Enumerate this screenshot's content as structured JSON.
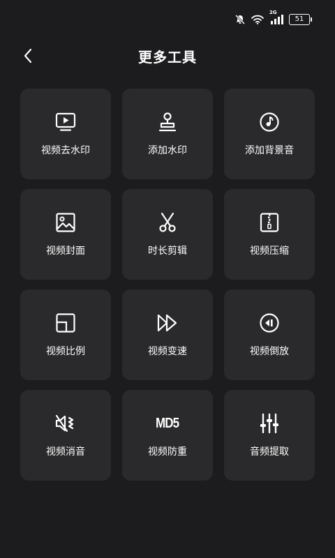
{
  "status_bar": {
    "network": "2G",
    "battery": "51"
  },
  "header": {
    "title": "更多工具"
  },
  "tools": [
    {
      "label": "视频去水印",
      "icon": "tv-play-icon"
    },
    {
      "label": "添加水印",
      "icon": "stamp-icon"
    },
    {
      "label": "添加背景音",
      "icon": "music-disc-icon"
    },
    {
      "label": "视频封面",
      "icon": "image-icon"
    },
    {
      "label": "时长剪辑",
      "icon": "scissors-icon"
    },
    {
      "label": "视频压缩",
      "icon": "zip-icon"
    },
    {
      "label": "视频比例",
      "icon": "aspect-ratio-icon"
    },
    {
      "label": "视频变速",
      "icon": "fast-forward-icon"
    },
    {
      "label": "视频倒放",
      "icon": "rewind-icon"
    },
    {
      "label": "视频消音",
      "icon": "mute-icon"
    },
    {
      "label": "视频防重",
      "icon": "md5-icon",
      "icon_text": "MD5"
    },
    {
      "label": "音频提取",
      "icon": "equalizer-icon"
    }
  ]
}
